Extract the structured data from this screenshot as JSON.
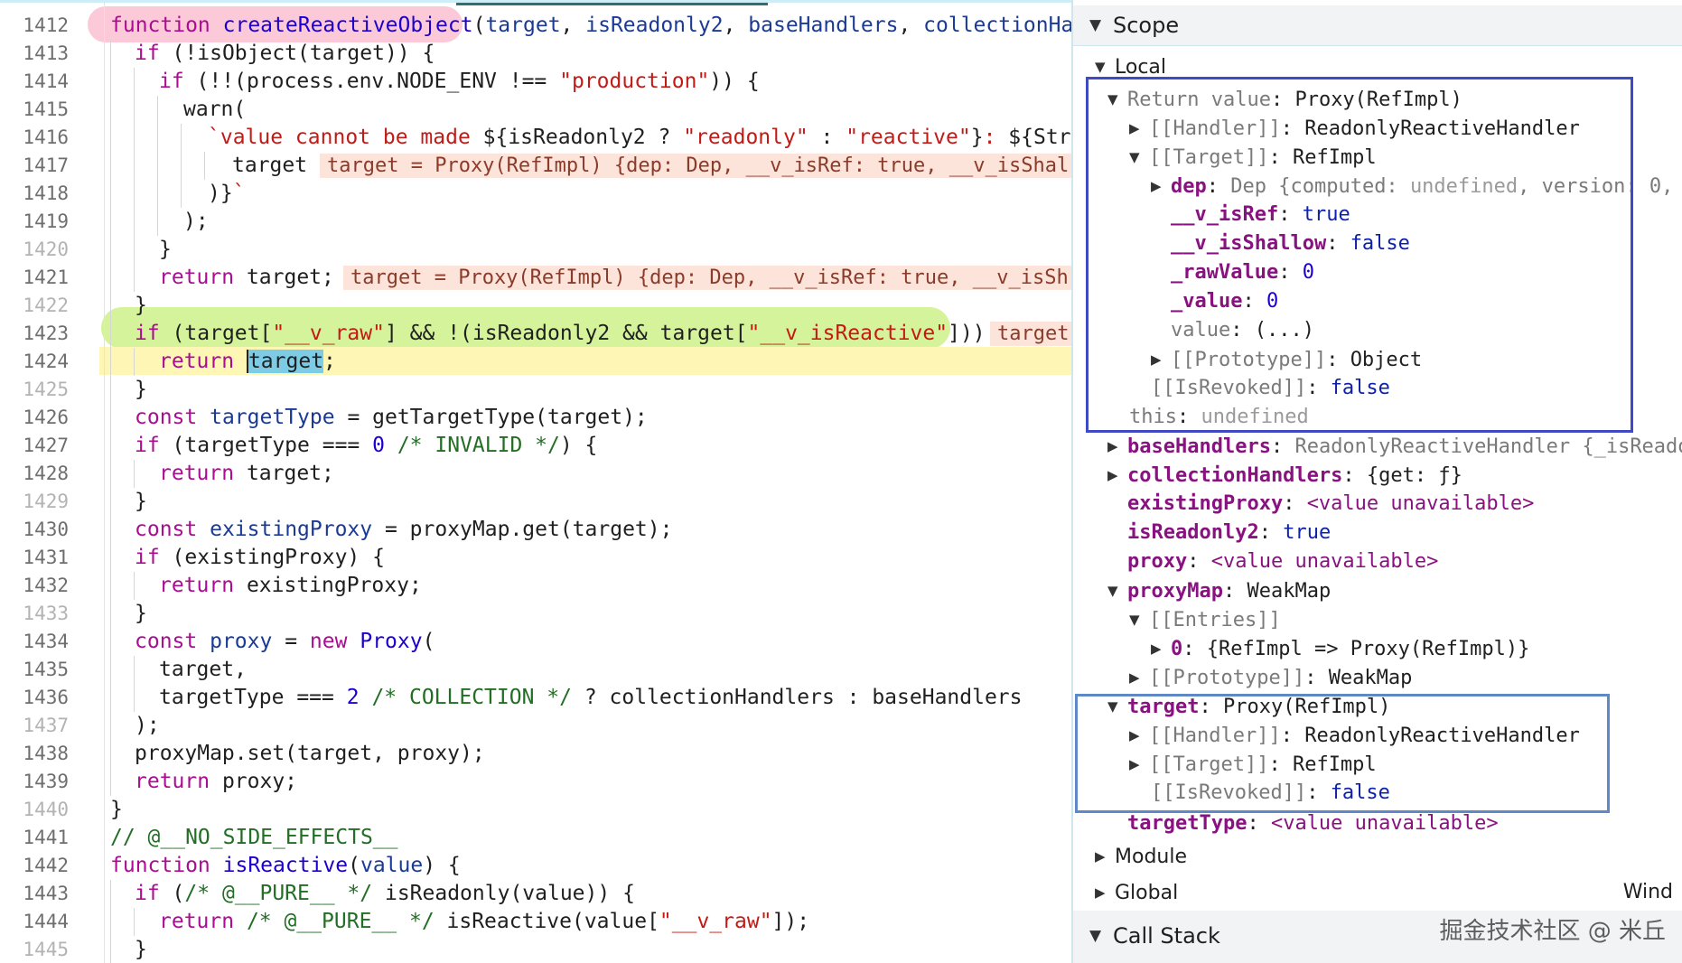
{
  "editor": {
    "lines": [
      {
        "n": "1412",
        "dim": false
      },
      {
        "n": "1413",
        "dim": false
      },
      {
        "n": "1414",
        "dim": false
      },
      {
        "n": "1415",
        "dim": false
      },
      {
        "n": "1416",
        "dim": false
      },
      {
        "n": "1417",
        "dim": false
      },
      {
        "n": "1418",
        "dim": false
      },
      {
        "n": "1419",
        "dim": false
      },
      {
        "n": "1420",
        "dim": true
      },
      {
        "n": "1421",
        "dim": false
      },
      {
        "n": "1422",
        "dim": true
      },
      {
        "n": "1423",
        "dim": false
      },
      {
        "n": "1424",
        "dim": false
      },
      {
        "n": "1425",
        "dim": true
      },
      {
        "n": "1426",
        "dim": false
      },
      {
        "n": "1427",
        "dim": false
      },
      {
        "n": "1428",
        "dim": false
      },
      {
        "n": "1429",
        "dim": true
      },
      {
        "n": "1430",
        "dim": false
      },
      {
        "n": "1431",
        "dim": false
      },
      {
        "n": "1432",
        "dim": false
      },
      {
        "n": "1433",
        "dim": true
      },
      {
        "n": "1434",
        "dim": false
      },
      {
        "n": "1435",
        "dim": false
      },
      {
        "n": "1436",
        "dim": false
      },
      {
        "n": "1437",
        "dim": true
      },
      {
        "n": "1438",
        "dim": false
      },
      {
        "n": "1439",
        "dim": false
      },
      {
        "n": "1440",
        "dim": true
      },
      {
        "n": "1441",
        "dim": false
      },
      {
        "n": "1442",
        "dim": false
      },
      {
        "n": "1443",
        "dim": false
      },
      {
        "n": "1444",
        "dim": false
      },
      {
        "n": "1445",
        "dim": true
      }
    ],
    "inline_values": {
      "l1417": "target = Proxy(RefImpl) {dep: Dep, __v_isRef: true, __v_isShal",
      "l1421": "target = Proxy(RefImpl) {dep: Dep, __v_isRef: true, __v_isSh",
      "l1423": "target"
    }
  },
  "scope": {
    "section_scope": "Scope",
    "local_label": "Local",
    "return_value": {
      "key": "Return value",
      "value": "Proxy(RefImpl)"
    },
    "handler": {
      "key": "[[Handler]]",
      "value": "ReadonlyReactiveHandler"
    },
    "target_internal": {
      "key": "[[Target]]",
      "value": "RefImpl"
    },
    "dep": {
      "key": "dep",
      "value_prefix": "Dep {computed: ",
      "value_undef": "undefined",
      "value_suffix": ", version: 0,"
    },
    "v_isRef": {
      "key": "__v_isRef",
      "value": "true"
    },
    "v_isShallow": {
      "key": "__v_isShallow",
      "value": "false"
    },
    "rawValue": {
      "key": "_rawValue",
      "value": "0"
    },
    "value_": {
      "key": "_value",
      "value": "0"
    },
    "value_getter": {
      "key": "value",
      "value": "(...)"
    },
    "prototype_obj": {
      "key": "[[Prototype]]",
      "value": "Object"
    },
    "isRevoked1": {
      "key": "[[IsRevoked]]",
      "value": "false"
    },
    "this_": {
      "key": "this",
      "value": "undefined"
    },
    "baseHandlers": {
      "key": "baseHandlers",
      "value": "ReadonlyReactiveHandler {_isReado"
    },
    "collectionHandlers": {
      "key": "collectionHandlers",
      "value": "{get: ƒ}"
    },
    "existingProxy": {
      "key": "existingProxy",
      "value": "<value unavailable>"
    },
    "isReadonly2": {
      "key": "isReadonly2",
      "value": "true"
    },
    "proxy": {
      "key": "proxy",
      "value": "<value unavailable>"
    },
    "proxyMap": {
      "key": "proxyMap",
      "value": "WeakMap"
    },
    "entries": {
      "key": "[[Entries]]"
    },
    "entry0": {
      "key": "0",
      "value": "{RefImpl => Proxy(RefImpl)}"
    },
    "prototype_wm": {
      "key": "[[Prototype]]",
      "value": "WeakMap"
    },
    "target": {
      "key": "target",
      "value": "Proxy(RefImpl)"
    },
    "handler2": {
      "key": "[[Handler]]",
      "value": "ReadonlyReactiveHandler"
    },
    "target_internal2": {
      "key": "[[Target]]",
      "value": "RefImpl"
    },
    "isRevoked2": {
      "key": "[[IsRevoked]]",
      "value": "false"
    },
    "targetType": {
      "key": "targetType",
      "value": "<value unavailable>"
    },
    "module_label": "Module",
    "global_label": "Global",
    "global_value": "Wind",
    "call_stack_label": "Call Stack"
  },
  "watermark": "掘金技术社区 @ 米丘"
}
